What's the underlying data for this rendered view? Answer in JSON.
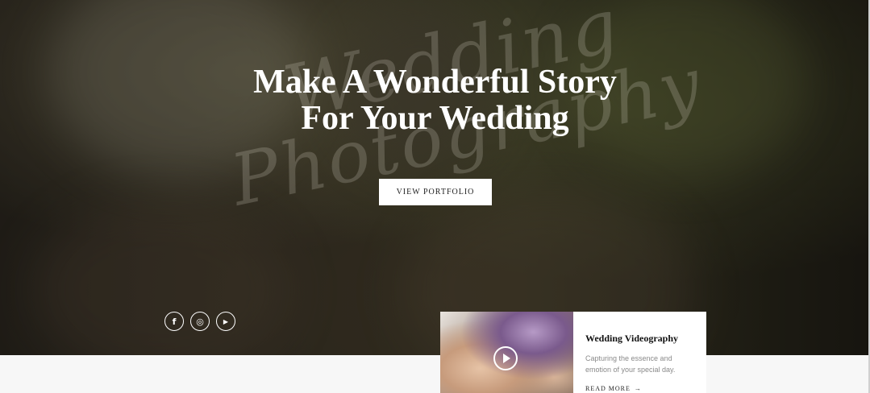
{
  "hero": {
    "script_word_1": "Wedding",
    "script_word_2": "Photography",
    "headline_line1": "Make A Wonderful Story",
    "headline_line2": "For Your Wedding",
    "cta_label": "VIEW PORTFOLIO"
  },
  "socials": [
    {
      "icon": "facebook-icon",
      "glyph": "f"
    },
    {
      "icon": "instagram-icon",
      "glyph": "◎"
    },
    {
      "icon": "youtube-icon",
      "glyph": "▶"
    }
  ],
  "card": {
    "title": "Wedding Videography",
    "description": "Capturing the essence and emotion of your special day.",
    "read_more": "READ MORE",
    "read_more_arrow": "→"
  },
  "colors": {
    "text_light": "#ffffff",
    "button_bg": "#ffffff",
    "card_bg": "#ffffff",
    "page_bg": "#f7f7f7"
  }
}
